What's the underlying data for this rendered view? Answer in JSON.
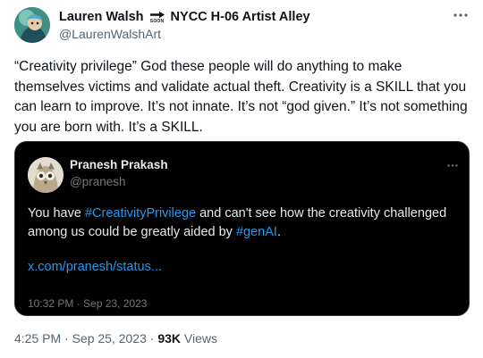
{
  "author": {
    "name": "Lauren Walsh",
    "soon_label": "SOON",
    "name_suffix": "NYCC H-06 Artist Alley",
    "handle": "@LaurenWalshArt"
  },
  "tweet": {
    "text": "“Creativity privilege” God these people will do anything to make themselves victims and validate actual theft. Creativity is a SKILL that you can learn to improve. It’s not innate. It’s not “god given.” It’s not something you are born with. It’s a SKILL."
  },
  "quoted": {
    "name": "Pranesh Prakash",
    "handle": "@pranesh",
    "text_before": "You have ",
    "hashtag_1": "#CreativityPrivilege",
    "text_middle": " and can't see how the creativity challenged among us could be greatly aided by ",
    "hashtag_2": "#genAI",
    "text_after": ".",
    "link": "x.com/pranesh/status...",
    "timestamp": "10:32 PM · Sep 23, 2023"
  },
  "footer": {
    "timestamp": "4:25 PM · Sep 25, 2023 · ",
    "views_count": "93K",
    "views_label": " Views"
  },
  "icons": {
    "more": "more-horizontal-icon",
    "soon_arrow": "soon-arrow-icon"
  },
  "colors": {
    "link_blue": "#1d9bf0",
    "secondary_text": "#536471",
    "quote_bg": "#000000"
  }
}
